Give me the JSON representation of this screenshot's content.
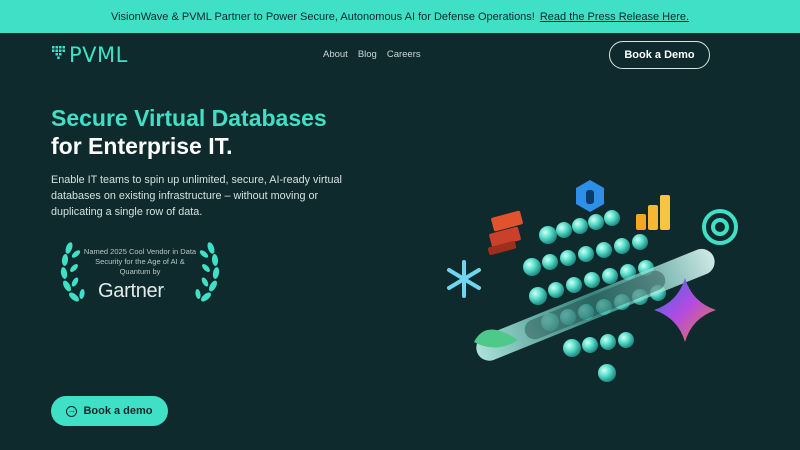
{
  "announcement": {
    "text": "VisionWave & PVML Partner to Power Secure, Autonomous AI for Defense Operations!",
    "link": "Read the Press Release Here."
  },
  "nav": {
    "logo": "PVML",
    "links": [
      "About",
      "Blog",
      "Careers"
    ],
    "demo_button": "Book a Demo"
  },
  "hero": {
    "title_line1": "Secure Virtual Databases",
    "title_line2": "for Enterprise IT.",
    "description": "Enable IT teams to spin up unlimited, secure, AI-ready virtual databases on existing infrastructure – without moving or duplicating a single row of data.",
    "badge_text": "Named 2025 Cool Vendor in Data Security for the Age of AI & Quantum by",
    "badge_brand": "Gartner",
    "cta": "Book a demo"
  },
  "colors": {
    "accent": "#3fe0c6",
    "background": "#0f2a2c"
  }
}
